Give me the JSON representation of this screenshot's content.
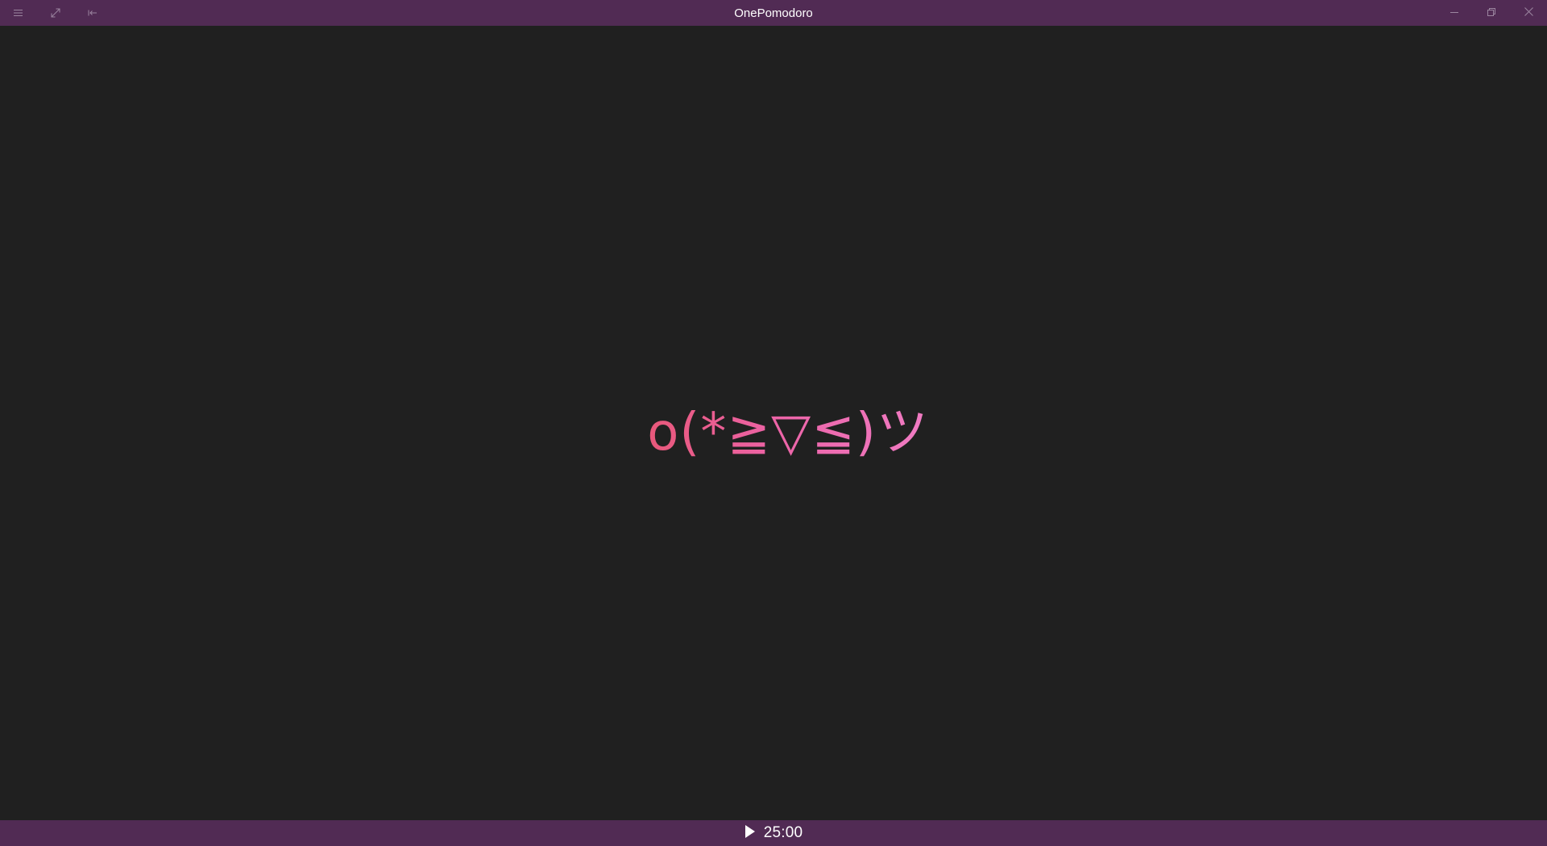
{
  "window": {
    "title": "OnePomodoro"
  },
  "titlebar": {
    "left_icons": [
      "hamburger-menu-icon",
      "expand-icon",
      "compact-overlay-icon"
    ],
    "window_controls": [
      "minimize-icon",
      "restore-icon",
      "close-icon"
    ]
  },
  "main": {
    "kaomoji": "o(*≧▽≦)ツ"
  },
  "bottombar": {
    "play_icon": "play-icon",
    "timer": "25:00"
  },
  "colors": {
    "titlebar_bg": "#512b54",
    "content_bg": "#202020",
    "kaomoji_start": "#e8587a",
    "kaomoji_end": "#f07cc4"
  }
}
